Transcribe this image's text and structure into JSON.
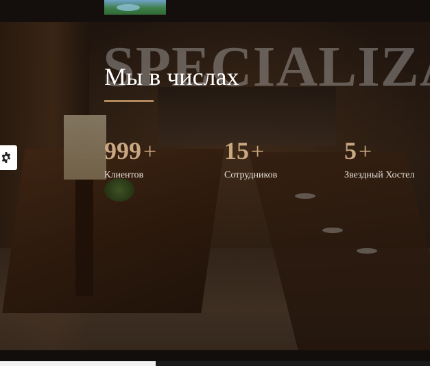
{
  "header": {
    "thumbnail_icon": "landscape-thumbnail"
  },
  "section": {
    "watermark": "SPECIALIZAT",
    "title": "Мы в числах",
    "accent_color": "#c9a781",
    "stats": [
      {
        "value": "999",
        "suffix": "+",
        "label": "Клиентов"
      },
      {
        "value": "15",
        "suffix": "+",
        "label": "Сотрудников"
      },
      {
        "value": "5",
        "suffix": "+",
        "label": "Звездный Хостел"
      }
    ]
  },
  "settings": {
    "icon": "gear-icon"
  }
}
